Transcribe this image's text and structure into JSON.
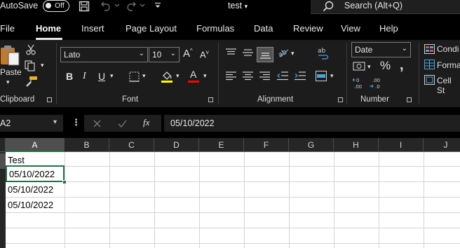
{
  "titlebar": {
    "autosave_label": "AutoSave",
    "autosave_state": "Off",
    "doc_title": "test",
    "search_placeholder": "Search (Alt+Q)"
  },
  "tabs": [
    "File",
    "Home",
    "Insert",
    "Page Layout",
    "Formulas",
    "Data",
    "Review",
    "View",
    "Help"
  ],
  "active_tab": "Home",
  "ribbon": {
    "clipboard": {
      "paste_label": "Paste",
      "group_label": "Clipboard"
    },
    "font": {
      "font_name": "Lato",
      "font_size": "10",
      "group_label": "Font",
      "highlight_color": "#ffff00",
      "font_color": "#ff0000"
    },
    "alignment": {
      "group_label": "Alignment"
    },
    "number": {
      "format": "Date",
      "group_label": "Number"
    },
    "styles": {
      "conditional": "Condi",
      "format_as": "Forma",
      "cell_styles": "Cell St"
    }
  },
  "formula_bar": {
    "name_box": "A2",
    "formula": "05/10/2022"
  },
  "sheet": {
    "columns": [
      "A",
      "B",
      "C",
      "D",
      "E",
      "F",
      "G",
      "H",
      "I",
      "J"
    ],
    "selected_column": "A",
    "cells": [
      "Test",
      "05/10/2022",
      "05/10/2022",
      "05/10/2022"
    ]
  },
  "colors": {
    "accent": "#217346",
    "ribbon_bg": "#1c1c1c",
    "titlebar_bg": "#000000"
  }
}
